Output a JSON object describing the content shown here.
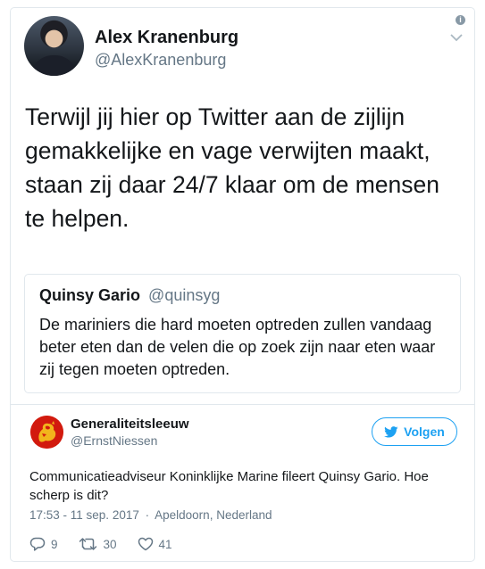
{
  "main_tweet": {
    "display_name": "Alex Kranenburg",
    "handle": "@AlexKranenburg",
    "text_lines": [
      "Terwijl jij hier op Twitter aan de zijlijn",
      "gemakkelijke en vage verwijten maakt,",
      "staan zij daar 24/7 klaar om de mensen",
      "te helpen."
    ],
    "info_icon_glyph": "i",
    "icons": [
      "info-icon",
      "chevron-down-icon"
    ]
  },
  "quoted_tweet": {
    "name": "Quinsy Gario",
    "handle": "@quinsyg",
    "text": "De mariniers die hard moeten optreden zullen vandaag beter eten dan de velen die op zoek zijn naar eten waar zij tegen moeten optreden."
  },
  "embedded_tweet": {
    "display_name": "Generaliteitsleeuw",
    "handle": "@ErnstNiessen",
    "follow_label": "Volgen",
    "text": "Communicatieadviseur Koninklijke Marine fileert Quinsy Gario. Hoe scherp is dit?",
    "time": "17:53 - 11 sep. 2017",
    "separator": "·",
    "location": "Apeldoorn, Nederland",
    "replies": "9",
    "retweets": "30",
    "likes": "41",
    "icons": [
      "twitter-bird-icon",
      "reply-icon",
      "retweet-icon",
      "heart-icon"
    ]
  },
  "colors": {
    "link_blue": "#1da1f2",
    "secondary_text": "#657786",
    "border": "#e1e8ed",
    "lion_red": "#d21a0e",
    "lion_gold": "#f2b51c"
  }
}
